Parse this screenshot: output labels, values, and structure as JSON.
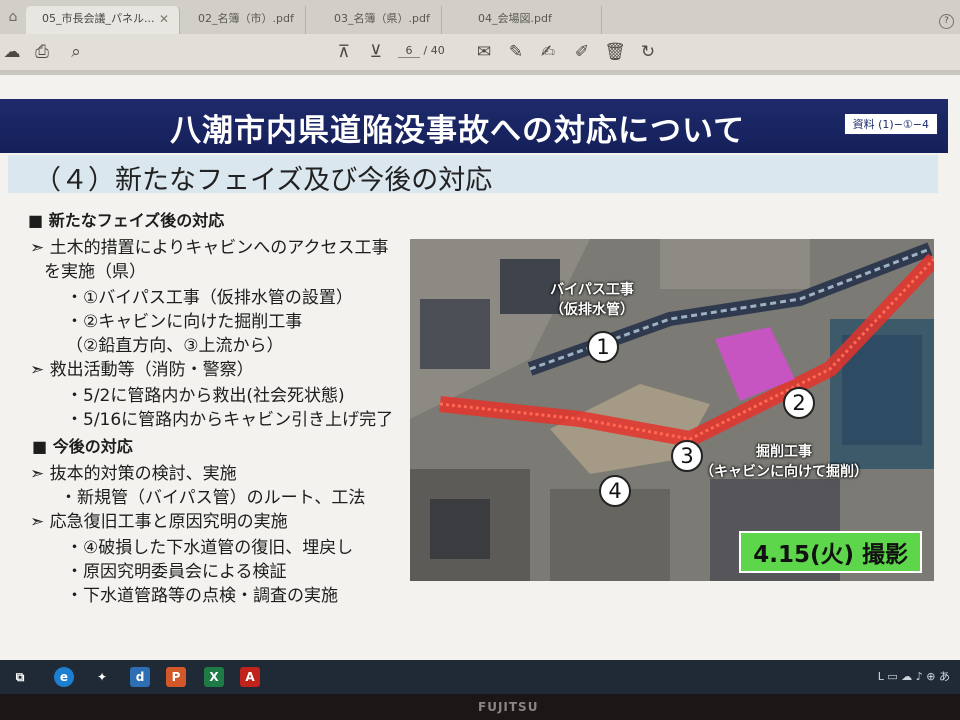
{
  "tabs": [
    {
      "label": "05_市長会議_パネル...",
      "active": true
    },
    {
      "label": "02_名簿（市）.pdf",
      "active": false
    },
    {
      "label": "03_名簿（県）.pdf",
      "active": false
    },
    {
      "label": "04_会場図.pdf",
      "active": false
    }
  ],
  "toolbar": {
    "page_current": "6",
    "page_total": "/ 40"
  },
  "slide": {
    "title": "八潮市内県道陥没事故への対応について",
    "ref_tag": "資料 (1)−①−4",
    "subtitle": "（４）新たなフェイズ及び今後の対応",
    "lines": [
      "■ 新たなフェイズ後の対応",
      "➣ 土木的措置によりキャビンへのアクセス工事",
      "を実施（県）",
      "・①バイパス工事（仮排水管の設置）",
      "・②キャビンに向けた掘削工事",
      "（②鉛直方向、③上流から）",
      "➣ 救出活動等（消防・警察）",
      "・5/2に管路内から救出(社会死状態)",
      "・5/16に管路内からキャビン引き上げ完了",
      "■ 今後の対応",
      "➣ 抜本的対策の検討、実施",
      "・新規管（バイパス管）のルート、工法",
      "➣ 応急復旧工事と原因究明の実施",
      "・④破損した下水道管の復旧、埋戻し",
      "・原因究明委員会による検証",
      "・下水道管路等の点検・調査の実施"
    ],
    "photo": {
      "label_bypass": "バイパス工事\n（仮排水管）",
      "label_excavation": "掘削工事\n（キャビンに向けて掘削）",
      "markers": [
        "1",
        "2",
        "3",
        "4"
      ],
      "date_badge": "4.15(火) 撮影"
    }
  },
  "taskbar": {
    "apps": [
      "d",
      "P",
      "X"
    ],
    "tray": "L ▭ ☁ ♪ ⊕ あ"
  },
  "bezel": {
    "brand": "FUJITSU"
  }
}
